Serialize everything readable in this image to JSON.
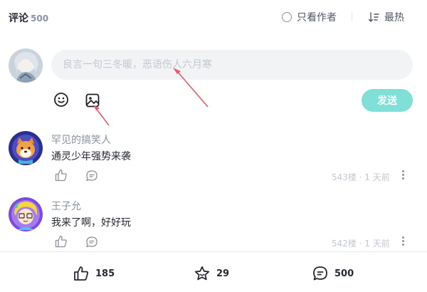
{
  "header": {
    "title": "评论",
    "count": "500",
    "only_author_label": "只看作者",
    "sort_label": "最热",
    "icons": {
      "only_author": "radio-icon",
      "sort": "sort-icon"
    }
  },
  "composer": {
    "placeholder": "良言一句三冬暖，恶语伤人六月寒",
    "send_label": "发送",
    "send_color": "#80e0d8",
    "icons": {
      "emoji": "emoji-icon",
      "image": "image-icon"
    }
  },
  "comments": [
    {
      "author": "罕见的搞笑人",
      "content": "通灵少年强势来袭",
      "meta": "543楼 · 1 天前"
    },
    {
      "author": "王子允",
      "content": "我来了啊，好好玩",
      "meta": "542楼 · 1 天前"
    }
  ],
  "bottom_bar": {
    "likes": "185",
    "collects": "29",
    "comments": "500",
    "icons": {
      "likes": "thumbs-up-icon",
      "collects": "star-icon",
      "comments": "comment-icon"
    }
  },
  "colors": {
    "accent": "#80e0d8",
    "annotation_arrow": "#e85a6a",
    "muted": "#8a919f",
    "text": "#252933"
  }
}
